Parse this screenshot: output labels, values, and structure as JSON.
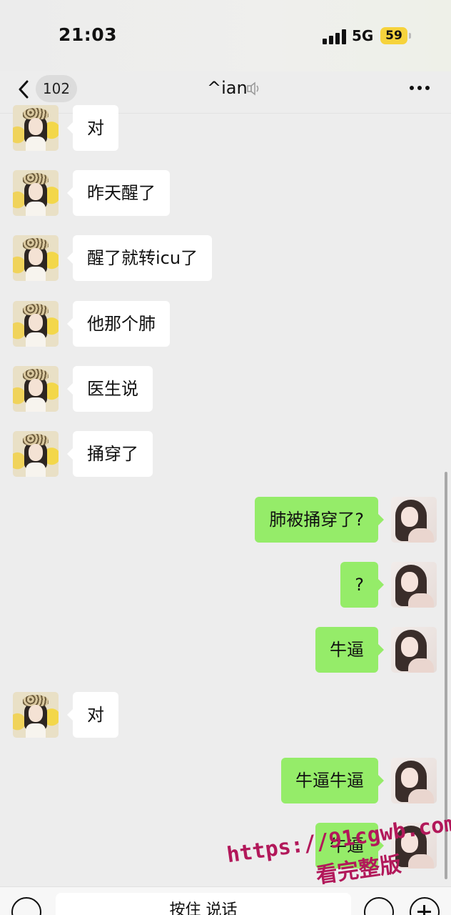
{
  "status_bar": {
    "time": "21:03",
    "network": "5G",
    "battery": "59"
  },
  "nav": {
    "unread_count": "102",
    "title": "^ian"
  },
  "messages": [
    {
      "sender": "them",
      "text": "对"
    },
    {
      "sender": "them",
      "text": "昨天醒了"
    },
    {
      "sender": "them",
      "text": "醒了就转icu了"
    },
    {
      "sender": "them",
      "text": "他那个肺"
    },
    {
      "sender": "them",
      "text": "医生说"
    },
    {
      "sender": "them",
      "text": "捅穿了"
    },
    {
      "sender": "me",
      "text": "肺被捅穿了?"
    },
    {
      "sender": "me",
      "text": "?"
    },
    {
      "sender": "me",
      "text": "牛逼"
    },
    {
      "sender": "them",
      "text": "对"
    },
    {
      "sender": "me",
      "text": "牛逼牛逼"
    },
    {
      "sender": "me",
      "text": "牛逼"
    }
  ],
  "input_bar": {
    "hold_to_talk": "按住 说话"
  },
  "watermark": {
    "url": "https://91cgwb.com",
    "text": "看完整版"
  },
  "icons": {
    "back": "chevron-left-icon",
    "more": "more-dots-icon",
    "voice_muted": "muted-sound-icon",
    "keyboard": "voice-keyboard-icon",
    "emoji": "emoji-icon",
    "plus": "plus-icon"
  },
  "colors": {
    "background": "#ededed",
    "bubble_me": "#95ec69",
    "bubble_them": "#ffffff",
    "watermark": "#b2185a",
    "battery": "#f6d33c"
  }
}
